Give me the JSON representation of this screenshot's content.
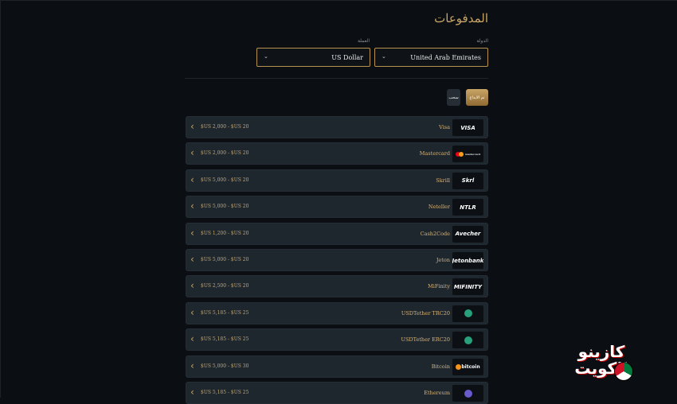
{
  "page": {
    "title": "المدفوعات"
  },
  "filters": {
    "country_label": "الدولة",
    "country_value": "United Arab Emirates",
    "currency_label": "العملة",
    "currency_value": "US Dollar"
  },
  "tabs": [
    {
      "label": "تم الايداع",
      "active": true
    },
    {
      "label": "سحب",
      "active": false
    }
  ],
  "methods": [
    {
      "name": "Visa",
      "range": "$US 2,000 - $US 20",
      "logo": "VISA",
      "logo_type": "text"
    },
    {
      "name": "Mastercard",
      "range": "$US 2,000 - $US 20",
      "logo": "mastercard",
      "logo_type": "mastercard"
    },
    {
      "name": "Skrill",
      "range": "$US 5,000 - $US 20",
      "logo": "Skrl",
      "logo_type": "text"
    },
    {
      "name": "Neteller",
      "range": "$US 5,000 - $US 20",
      "logo": "NTLR",
      "logo_type": "text"
    },
    {
      "name": "Cash2Code",
      "range": "$US 1,200 - $US 20",
      "logo": "Avecher",
      "logo_type": "text"
    },
    {
      "name": "Jeton",
      "range": "$US 5,000 - $US 20",
      "logo": "Jetonbank",
      "logo_type": "text"
    },
    {
      "name": "MiFinity",
      "range": "$US 2,500 - $US 20",
      "logo": "MIFINITY",
      "logo_type": "text"
    },
    {
      "name": "USDTether TRC20",
      "range": "$US 5,185 - $US 25",
      "logo": "tether-coin-icon",
      "logo_type": "tether"
    },
    {
      "name": "USDTether ERC20",
      "range": "$US 5,185 - $US 25",
      "logo": "tether-coin-icon",
      "logo_type": "tether"
    },
    {
      "name": "Bitcoin",
      "range": "$US 5,000 - $US 30",
      "logo": "bitcoin",
      "logo_type": "bitcoin"
    },
    {
      "name": "Ethereum",
      "range": "$US 5,185 - $US 25",
      "logo": "ethereum-coin-icon",
      "logo_type": "eth"
    }
  ],
  "watermark": {
    "line1": "كازينو",
    "line2": "الكويت"
  },
  "colors": {
    "accent": "#c9a566",
    "row_bg": "#1e262e",
    "page_bg": "#0b0e12"
  }
}
